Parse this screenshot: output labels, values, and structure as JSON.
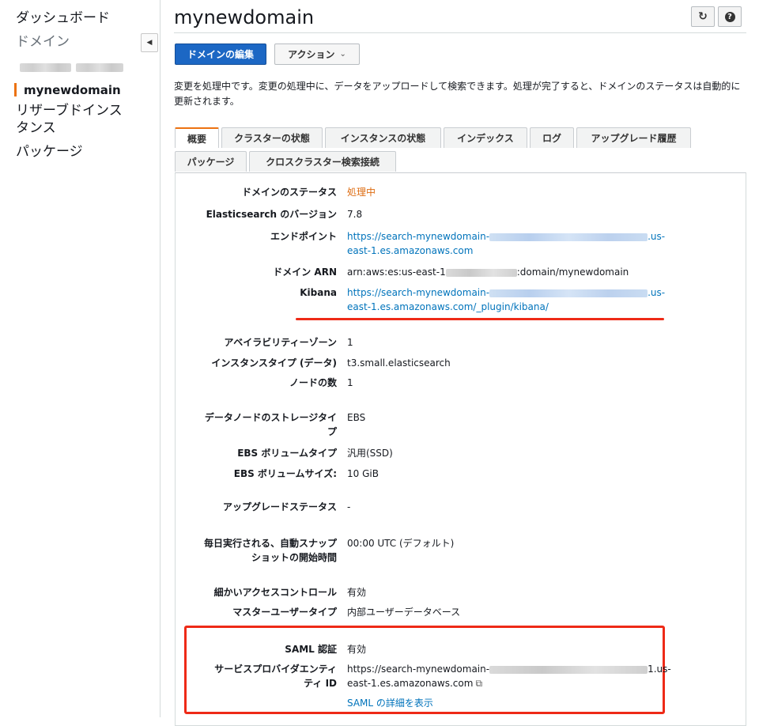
{
  "sidebar": {
    "items": [
      {
        "label": "ダッシュボード"
      },
      {
        "label": "ドメイン"
      },
      {
        "label": "mynewdomain"
      },
      {
        "label": "リザーブドインスタンス"
      },
      {
        "label": "パッケージ"
      }
    ]
  },
  "header": {
    "title": "mynewdomain",
    "edit_button": "ドメインの編集",
    "actions_button": "アクション"
  },
  "notice": "変更を処理中です。変更の処理中に、データをアップロードして検索できます。処理が完了すると、ドメインのステータスは自動的に更新されます。",
  "tabs": [
    {
      "label": "概要"
    },
    {
      "label": "クラスターの状態"
    },
    {
      "label": "インスタンスの状態"
    },
    {
      "label": "インデックス"
    },
    {
      "label": "ログ"
    },
    {
      "label": "アップグレード履歴"
    },
    {
      "label": "パッケージ"
    },
    {
      "label": "クロスクラスター検索接続"
    }
  ],
  "details": {
    "status_label": "ドメインのステータス",
    "status_value": "処理中",
    "version_label": "Elasticsearch のバージョン",
    "version_value": "7.8",
    "endpoint_label": "エンドポイント",
    "endpoint_a": "https://search-mynewdomain-",
    "endpoint_b": ".us-",
    "endpoint_c": "east-1.es.amazonaws.com",
    "arn_label": "ドメイン ARN",
    "arn_a": "arn:aws:es:us-east-1",
    "arn_b": ":domain/mynewdomain",
    "kibana_label": "Kibana",
    "kibana_a": "https://search-mynewdomain-",
    "kibana_b": ".us-",
    "kibana_c": "east-1.es.amazonaws.com/_plugin/kibana/",
    "az_label": "アベイラビリティーゾーン",
    "az_value": "1",
    "instance_type_label": "インスタンスタイプ (データ)",
    "instance_type_value": "t3.small.elasticsearch",
    "node_count_label": "ノードの数",
    "node_count_value": "1",
    "storage_label_1": "データノードのストレージタイ",
    "storage_label_2": "プ",
    "storage_value": "EBS",
    "ebs_type_label": "EBS ボリュームタイプ",
    "ebs_type_value": "汎用(SSD)",
    "ebs_size_label": "EBS ボリュームサイズ:",
    "ebs_size_value": "10 GiB",
    "upgrade_label": "アップグレードステータス",
    "upgrade_value": "-",
    "snapshot_label_1": "毎日実行される、自動スナップ",
    "snapshot_label_2": "ショットの開始時間",
    "snapshot_value": "00:00 UTC (デフォルト)",
    "fgac_label": "細かいアクセスコントロール",
    "fgac_value": "有効",
    "master_user_label": "マスターユーザータイプ",
    "master_user_value": "内部ユーザーデータベース",
    "saml_label": "SAML 認証",
    "saml_value": "有効",
    "sp_label_1": "サービスプロバイダエンティ",
    "sp_label_2": "ティ ID",
    "sp_a": "https://search-mynewdomain-",
    "sp_b": "1.us-",
    "sp_c": "east-1.es.amazonaws.com",
    "saml_link": "SAML の詳細を表示"
  },
  "colors": {
    "accent": "#ec7211",
    "primary_button": "#1c67c4",
    "link": "#0073bb",
    "highlight": "#ee2a17",
    "status_orange": "#dd6b10"
  },
  "icons": {
    "refresh": "refresh-icon",
    "help": "help-icon",
    "collapse": "collapse-left-icon",
    "dropdown": "chevron-down-icon",
    "copy": "copy-icon"
  }
}
